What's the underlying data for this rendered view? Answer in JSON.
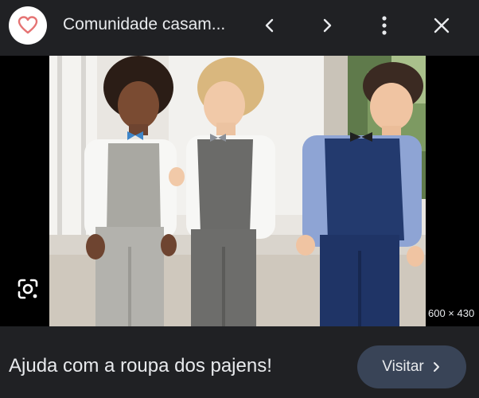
{
  "header": {
    "site_title": "Comunidade casam...",
    "logo_icon": "heart-icon",
    "prev_icon": "chevron-left-icon",
    "next_icon": "chevron-right-icon",
    "more_icon": "more-vert-icon",
    "close_icon": "close-icon"
  },
  "image": {
    "dimensions": "600 × 430",
    "lens_icon": "lens-search-icon"
  },
  "footer": {
    "caption": "Ajuda com a roupa dos pajens!",
    "visit_label": "Visitar",
    "visit_icon": "chevron-right-icon"
  },
  "colors": {
    "background": "#202124",
    "visit_button": "#394457",
    "logo_heart": "#e57373"
  }
}
